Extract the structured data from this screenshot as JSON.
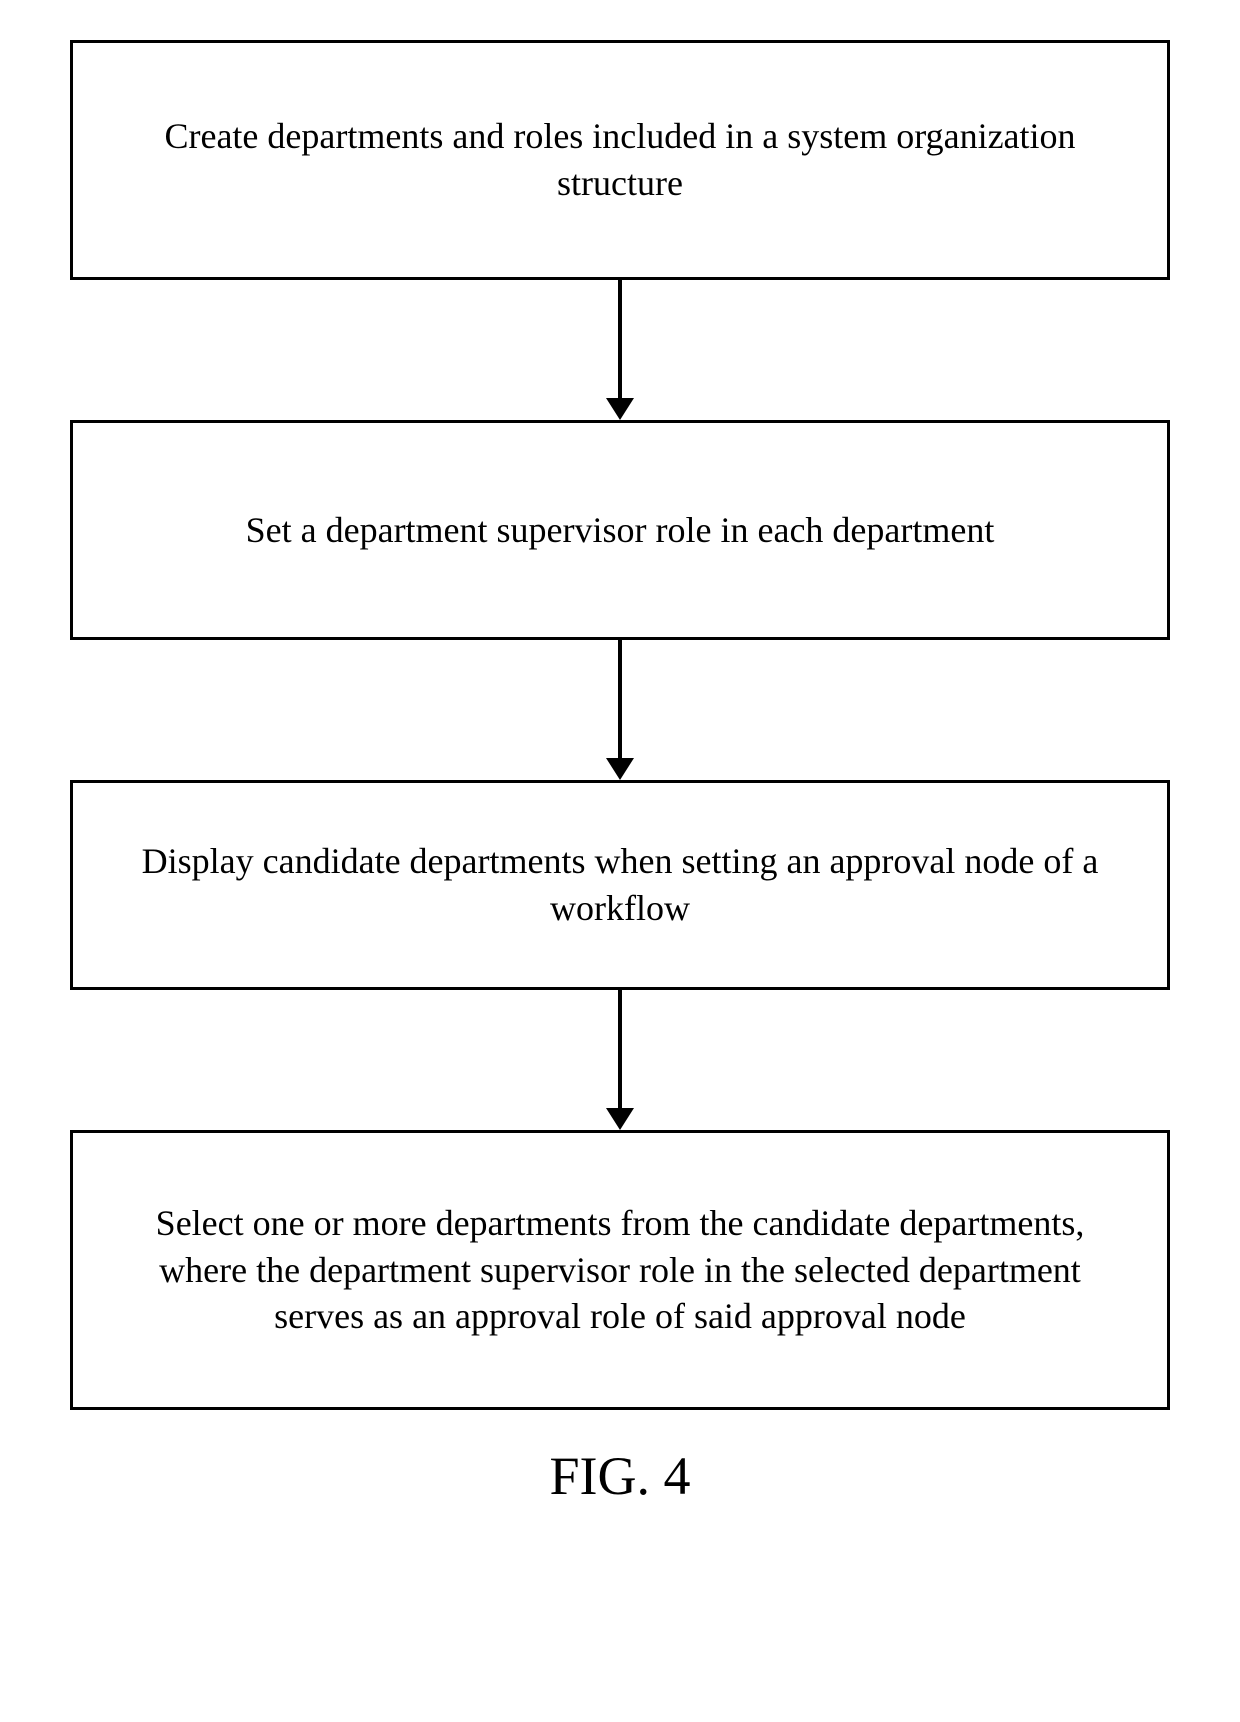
{
  "flow": {
    "steps": [
      {
        "text": "Create departments and roles included in a system organization structure"
      },
      {
        "text": "Set a department supervisor role in each department"
      },
      {
        "text": "Display candidate departments when setting an approval node of a workflow"
      },
      {
        "text": "Select one or more departments from the candidate departments, where the department supervisor role in the selected department serves as an approval role of said approval node"
      }
    ]
  },
  "caption": "FIG. 4"
}
